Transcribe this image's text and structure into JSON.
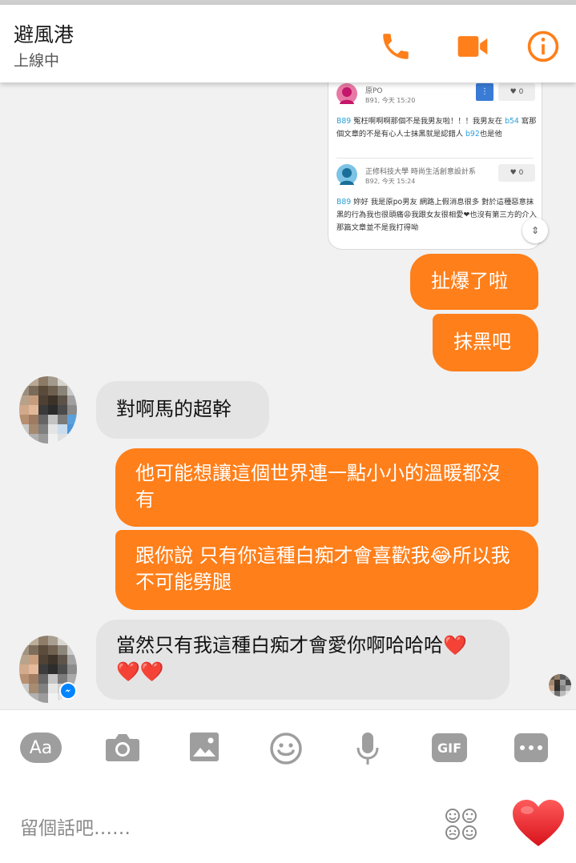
{
  "header": {
    "contact_name": "避風港",
    "status": "上線中"
  },
  "card": {
    "comment1": {
      "author": "原PO",
      "meta": "B91, 今天 15:20",
      "like": "0",
      "ref1": "B89",
      "text1": " 冤枉啊啊啊那個不是我男友啦！！！我男友在 ",
      "ref2": "b54",
      "text2": " 寫那個文章的不是有心人士抹黑就是認錯人 ",
      "ref3": "b92",
      "text3": "也是他"
    },
    "comment2": {
      "author": "正修科技大學 時尚生活創意設計系",
      "meta": "B92, 今天 15:24",
      "like": "0",
      "ref1": "B89",
      "text1": " 妳好 我是原po男友 網路上假消息很多 對於這種惡意抹黑的行為我也很頭痛😩我跟女友很相愛❤也沒有第三方的介入 那篇文章並不是我打得呦"
    }
  },
  "messages": [
    {
      "dir": "out",
      "text": "扯爆了啦"
    },
    {
      "dir": "out",
      "text": "抹黑吧"
    },
    {
      "dir": "in",
      "text": "對啊馬的超幹"
    },
    {
      "dir": "out",
      "text": "他可能想讓這個世界連一點小小的溫暖都沒有"
    },
    {
      "dir": "out",
      "text": "跟你說 只有你這種白痴才會喜歡我😂所以我不可能劈腿"
    },
    {
      "dir": "in",
      "text": "當然只有我這種白痴才會愛你啊哈哈哈❤️❤️❤️"
    }
  ],
  "composer": {
    "aa_label": "Aa",
    "gif_label": "GIF",
    "placeholder": "留個話吧……"
  },
  "colors": {
    "accent": "#ff7f1a",
    "incoming_bubble": "#e4e4e4",
    "background": "#f1f1f1"
  }
}
